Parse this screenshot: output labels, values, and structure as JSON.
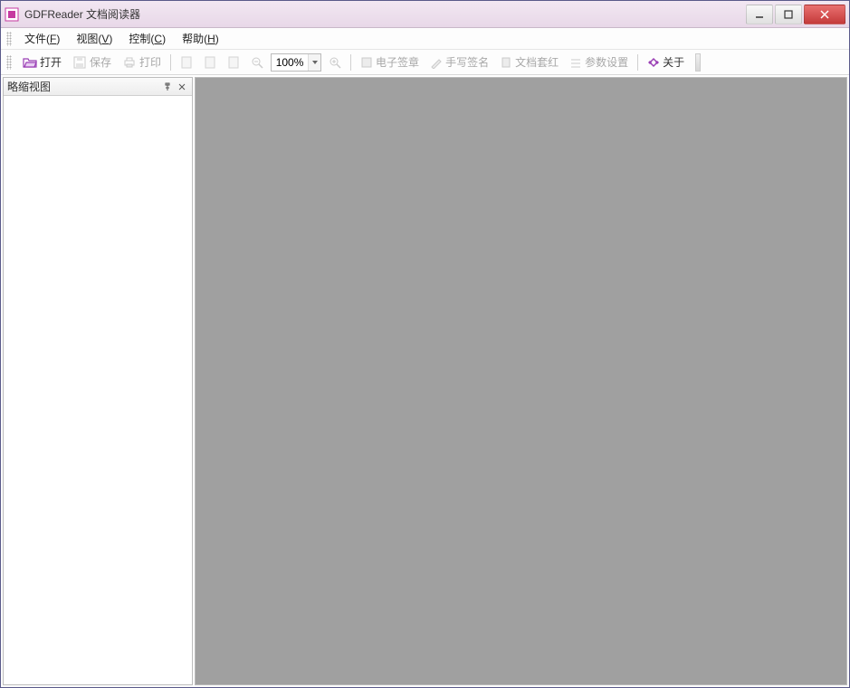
{
  "app": {
    "title": "GDFReader 文档阅读器"
  },
  "menu": {
    "file": "文件",
    "file_m": "F",
    "view": "视图",
    "view_m": "V",
    "control": "控制",
    "control_m": "C",
    "help": "帮助",
    "help_m": "H"
  },
  "toolbar": {
    "open": "打开",
    "save": "保存",
    "print": "打印",
    "zoom_value": "100%",
    "esign": "电子签章",
    "handsign": "手写签名",
    "docred": "文档套红",
    "params": "参数设置",
    "about": "关于"
  },
  "sidepanel": {
    "title": "略缩视图"
  },
  "colors": {
    "accent": "#9a3fb5",
    "titlebar_bg": "#e8d8e8",
    "viewer_bg": "#a0a0a0"
  }
}
